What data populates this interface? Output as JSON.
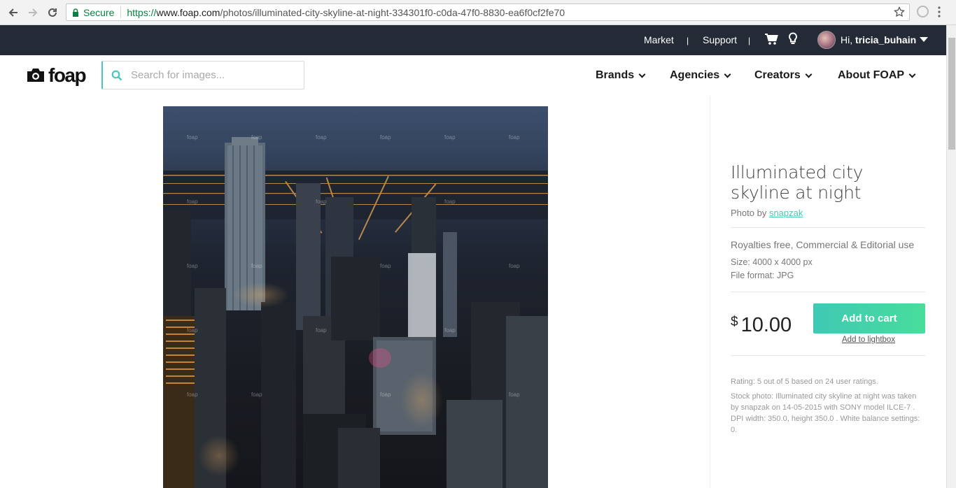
{
  "browser": {
    "secure_label": "Secure",
    "url_scheme": "https://",
    "url_host": "www.foap.com",
    "url_path": "/photos/illuminated-city-skyline-at-night-334301f0-c0da-47f0-8830-ea6f0cf2fe70"
  },
  "topbar": {
    "market": "Market",
    "support": "Support",
    "separator": "|",
    "greeting": "Hi, ",
    "username": "tricia_buhain"
  },
  "header": {
    "logo_text": "foap",
    "search_placeholder": "Search for images...",
    "nav": [
      "Brands",
      "Agencies",
      "Creators",
      "About FOAP"
    ]
  },
  "photo": {
    "watermark": "foap"
  },
  "details": {
    "title": "Illuminated city skyline at night",
    "photo_by": "Photo by ",
    "author": "snapzak",
    "rights": "Royalties free, Commercial & Editorial use",
    "size": "Size: 4000 x 4000 px",
    "format": "File format: JPG",
    "currency": "$",
    "price": "10.00",
    "add_to_cart": "Add to cart",
    "add_to_lightbox": "Add to lightbox",
    "rating": "Rating: 5  out of 5  based on 24 user ratings.",
    "description": "Stock photo: Illuminated city skyline at night was taken by snapzak on 14-05-2015 with SONY model ILCE-7 . DPI width: 350.0, height 350.0 . White balance settings: 0."
  },
  "colors": {
    "accent": "#47c9b6",
    "topbar": "#242b36",
    "cart_gradient_end": "#48dd9c"
  }
}
